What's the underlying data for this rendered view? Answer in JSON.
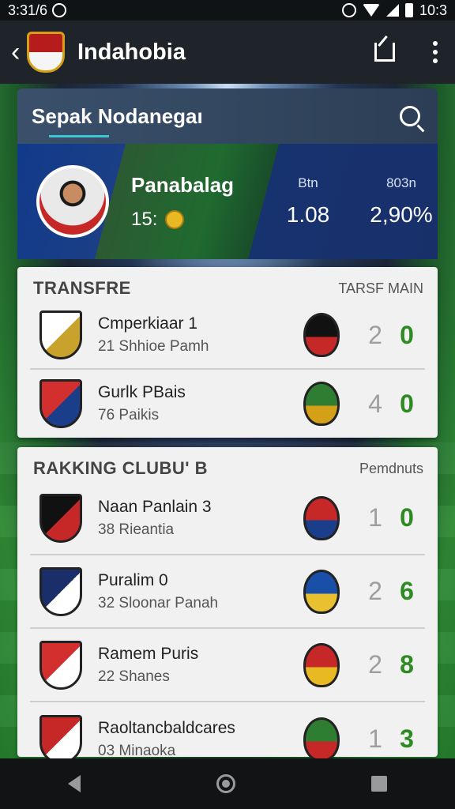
{
  "status_bar": {
    "time_left": "3:31/6",
    "time_right": "10:3"
  },
  "app_bar": {
    "title": "Indahobia"
  },
  "search": {
    "text": "Sepak Nodanegaı"
  },
  "hero": {
    "name": "Panabalag",
    "sub": "15:",
    "stats": [
      {
        "label": "Btn",
        "value": "1.08"
      },
      {
        "label": "803n",
        "value": "2,90%"
      }
    ]
  },
  "transfer": {
    "title": "TRANSFRE",
    "subtitle": "TARSF MAIN",
    "rows": [
      {
        "title": "Cmperkiaar 1",
        "sub": "21 Shhioe Pamh",
        "score_a": "2",
        "score_b": "0",
        "crest_colors": [
          "#ffffff",
          "#c8a22a"
        ],
        "badge_colors": [
          "#111111",
          "#c62828"
        ]
      },
      {
        "title": "Gurlk PBais",
        "sub": "76 Paikis",
        "score_a": "4",
        "score_b": "0",
        "crest_colors": [
          "#d32f2f",
          "#1a3e8a"
        ],
        "badge_colors": [
          "#2e7d32",
          "#d4a017"
        ]
      }
    ]
  },
  "ranking": {
    "title": "RAKKING CLUBU' B",
    "subtitle": "Pemdnuts",
    "rows": [
      {
        "title": "Naan Panlain 3",
        "sub": "38 Rieantia",
        "score_a": "1",
        "score_b": "0",
        "crest_colors": [
          "#111111",
          "#c62828"
        ],
        "badge_colors": [
          "#c62828",
          "#1a3e8a"
        ]
      },
      {
        "title": "Puralim 0",
        "sub": "32 Sloonar Panah",
        "score_a": "2",
        "score_b": "6",
        "crest_colors": [
          "#1a2f6a",
          "#ffffff"
        ],
        "badge_colors": [
          "#1a4fa8",
          "#e8c030"
        ]
      },
      {
        "title": "Ramem Puris",
        "sub": "22 Shanes",
        "score_a": "2",
        "score_b": "8",
        "crest_colors": [
          "#d32f2f",
          "#ffffff"
        ],
        "badge_colors": [
          "#c62828",
          "#e8b923"
        ]
      },
      {
        "title": "Raoltancbaldcares",
        "sub": "03 Minaoka",
        "score_a": "1",
        "score_b": "3",
        "crest_colors": [
          "#c62828",
          "#ffffff"
        ],
        "badge_colors": [
          "#2e7d32",
          "#c62828"
        ]
      }
    ]
  }
}
